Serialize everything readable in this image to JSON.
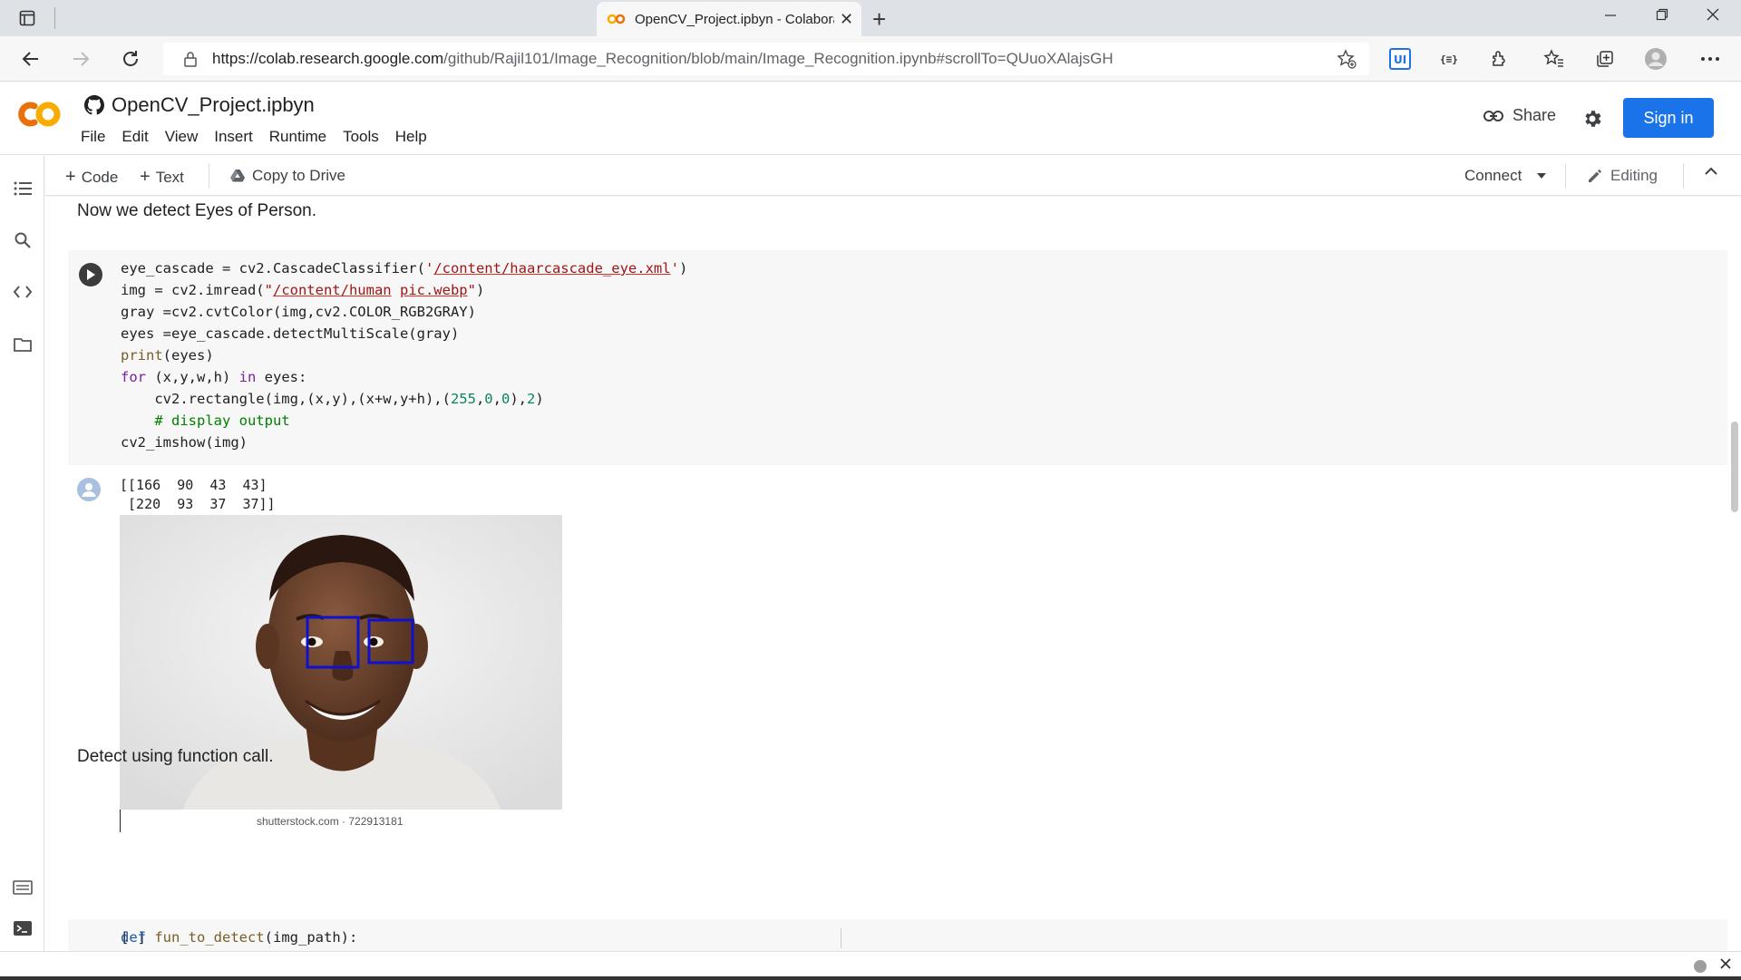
{
  "browser": {
    "tab_title": "OpenCV_Project.ipbyn - Colaboratory",
    "url_scheme_host": "https://colab.research.google.com",
    "url_path": "/github/Rajil101/Image_Recognition/blob/main/Image_Recognition.ipynb#scrollTo=QUuoXAlajsGH"
  },
  "colab": {
    "logo_text": "CO",
    "notebook_title": "OpenCV_Project.ipbyn",
    "menu": [
      "File",
      "Edit",
      "View",
      "Insert",
      "Runtime",
      "Tools",
      "Help"
    ],
    "share_label": "Share",
    "signin_label": "Sign in"
  },
  "toolbar": {
    "code_label": "Code",
    "text_label": "Text",
    "copy_to_drive_label": "Copy to Drive",
    "connect_label": "Connect",
    "editing_label": "Editing"
  },
  "notebook": {
    "text_cell_1": "Now we detect Eyes of Person.",
    "output_lines": [
      "[[166  90  43  43]",
      " [220  93  37  37]]"
    ],
    "image_caption": "shutterstock.com · 722913181",
    "text_cell_2": "Detect using function call.",
    "cell2_bracket": "[ ]"
  },
  "colors": {
    "accent": "#1a73e8",
    "colab_orange": "#f9ab00",
    "cell_bg": "#f7f7f7",
    "detection_box": "#1010d0"
  }
}
